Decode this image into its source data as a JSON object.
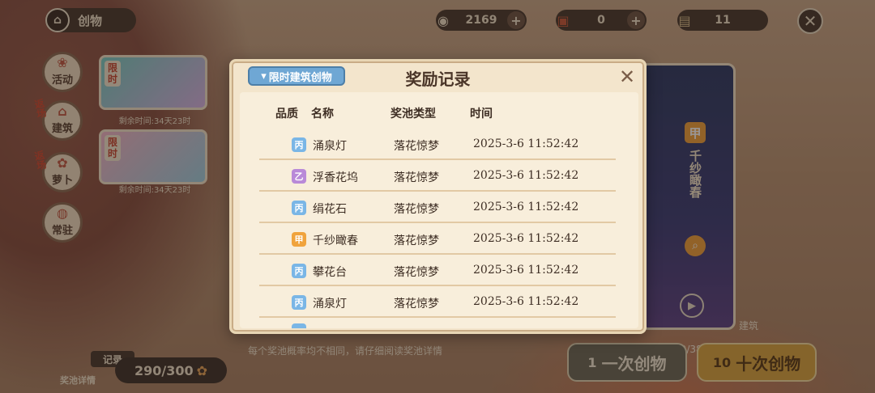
{
  "header": {
    "title": "创物",
    "resources": [
      {
        "icon": "coin-icon",
        "value": "2169"
      },
      {
        "icon": "ticket-icon",
        "value": "0"
      },
      {
        "icon": "scroll-icon",
        "value": "11"
      }
    ]
  },
  "sidebar": {
    "items": [
      {
        "label": "活动",
        "tag": ""
      },
      {
        "label": "建筑",
        "tag": "返场"
      },
      {
        "label": "萝卜",
        "tag": "返场"
      },
      {
        "label": "常驻",
        "tag": ""
      }
    ],
    "banners": [
      {
        "tag": "限时",
        "time": "剩余时间:34天23时"
      },
      {
        "tag": "限时",
        "time": "剩余时间:34天23时"
      }
    ]
  },
  "modal": {
    "title": "奖励记录",
    "filter_label": "限时建筑创物",
    "columns": {
      "quality": "品质",
      "name": "名称",
      "pool": "奖池类型",
      "time": "时间"
    },
    "records": [
      {
        "grade": "丙",
        "name": "涌泉灯",
        "pool": "落花惊梦",
        "time": "2025-3-6  11:52:42"
      },
      {
        "grade": "乙",
        "name": "浮香花坞",
        "pool": "落花惊梦",
        "time": "2025-3-6  11:52:42"
      },
      {
        "grade": "丙",
        "name": "绢花石",
        "pool": "落花惊梦",
        "time": "2025-3-6  11:52:42"
      },
      {
        "grade": "甲",
        "name": "千纱瞰春",
        "pool": "落花惊梦",
        "time": "2025-3-6  11:52:42"
      },
      {
        "grade": "丙",
        "name": "攀花台",
        "pool": "落花惊梦",
        "time": "2025-3-6  11:52:42"
      },
      {
        "grade": "丙",
        "name": "涌泉灯",
        "pool": "落花惊梦",
        "time": "2025-3-6  11:52:42"
      }
    ]
  },
  "right_card": {
    "grade": "甲",
    "name": "千纱瞰春"
  },
  "bottom": {
    "hint": "每个奖池概率均不相同，请仔细阅读奖池详情",
    "record_label": "记录",
    "pool_detail_label": "奖池详情",
    "counter": "290/300",
    "daily_count": "今日创物次数:10/388",
    "draw_one": {
      "count": "1",
      "label": "一次创物"
    },
    "draw_ten": {
      "count": "10",
      "label": "十次创物"
    },
    "corner_label": "建筑"
  }
}
